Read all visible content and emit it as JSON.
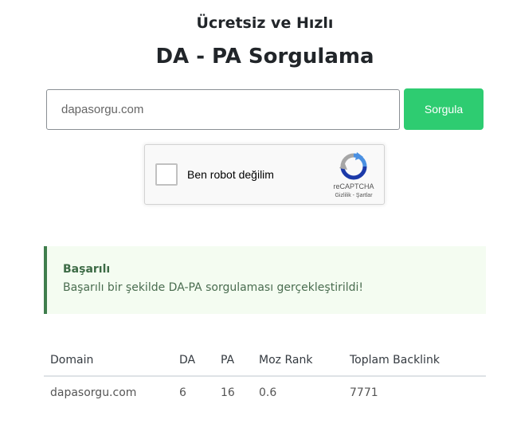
{
  "header": {
    "subtitle": "Ücretsiz ve Hızlı",
    "title": "DA - PA Sorgulama"
  },
  "form": {
    "input_value": "dapasorgu.com",
    "input_placeholder": "dapasorgu.com",
    "submit_label": "Sorgula",
    "submit_color": "#2ecc71"
  },
  "recaptcha": {
    "label": "Ben robot değilim",
    "brand": "reCAPTCHA",
    "links": "Gizlilik - Şartlar",
    "icon": "recaptcha-logo-icon"
  },
  "alert": {
    "title": "Başarılı",
    "message": "Başarılı bir şekilde DA-PA sorgulaması gerçekleştirildi!",
    "accent_color": "#3f7d4d",
    "background": "#f4fcf1"
  },
  "results": {
    "columns": [
      "Domain",
      "DA",
      "PA",
      "Moz Rank",
      "Toplam Backlink"
    ],
    "rows": [
      [
        "dapasorgu.com",
        "6",
        "16",
        "0.6",
        "7771"
      ]
    ]
  }
}
